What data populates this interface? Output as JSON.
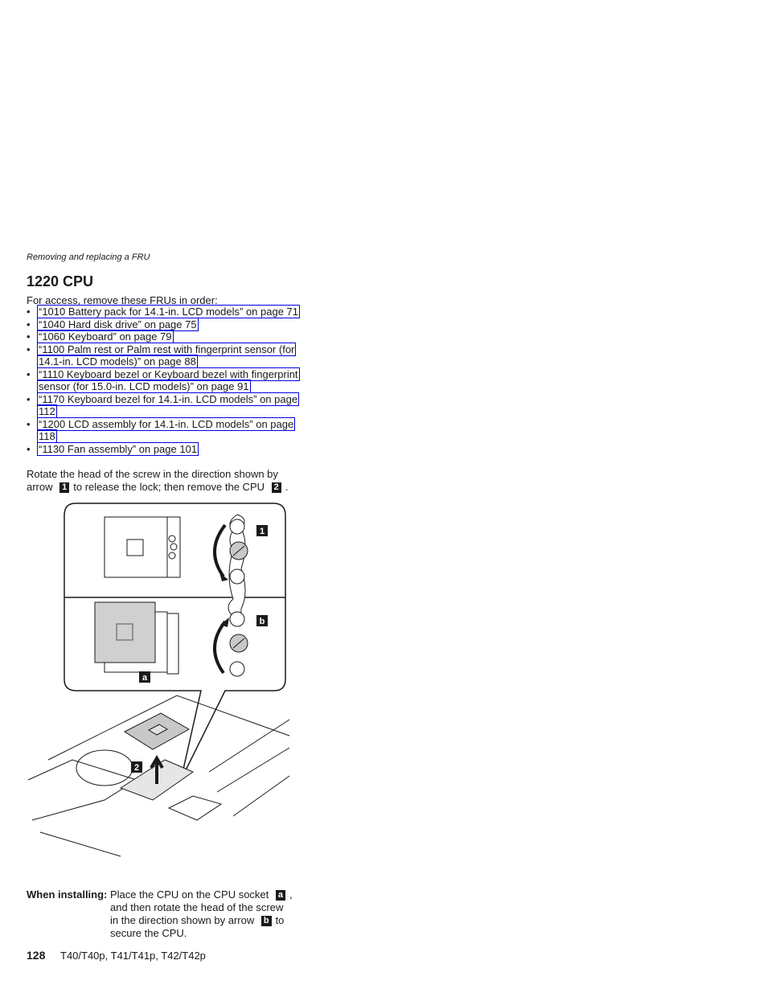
{
  "header": {
    "running_title": "Removing and replacing a FRU"
  },
  "section": {
    "title": "1220 CPU",
    "intro": "For access, remove these FRUs in order:",
    "fru_links": [
      {
        "lines": [
          "“1010 Battery pack for 14.1-in. LCD models” on page 71"
        ]
      },
      {
        "lines": [
          "“1040 Hard disk drive” on page 75"
        ]
      },
      {
        "lines": [
          "“1060 Keyboard” on page 79"
        ]
      },
      {
        "lines": [
          "“1100 Palm rest or Palm rest with fingerprint sensor (for",
          "14.1-in. LCD models)” on page 88"
        ]
      },
      {
        "lines": [
          "“1110 Keyboard bezel or Keyboard bezel with fingerprint",
          "sensor (for 15.0-in. LCD models)” on page 91"
        ]
      },
      {
        "lines": [
          "“1170 Keyboard bezel for 14.1-in. LCD models” on page",
          "112"
        ]
      },
      {
        "lines": [
          "“1200 LCD assembly for 14.1-in. LCD models” on page",
          "118"
        ]
      },
      {
        "lines": [
          "“1130 Fan assembly” on page 101"
        ]
      }
    ],
    "bullet": "•",
    "step_text_1": "Rotate the head of the screw in the direction shown by arrow",
    "step_callout_1": "1",
    "step_text_2": "to release the lock; then remove the CPU",
    "step_callout_2": "2",
    "step_text_3": "."
  },
  "figure": {
    "callouts": {
      "one": "1",
      "b": "b",
      "a": "a",
      "two": "2"
    }
  },
  "installing": {
    "label": "When installing:",
    "text_1": "Place the CPU on the CPU socket",
    "callout_a": "a",
    "text_2": ", and then rotate the head of the screw in the direction shown by arrow",
    "callout_b": "b",
    "text_3": "to secure the CPU."
  },
  "footer": {
    "page_number": "128",
    "models": "T40/T40p, T41/T41p, T42/T42p"
  }
}
